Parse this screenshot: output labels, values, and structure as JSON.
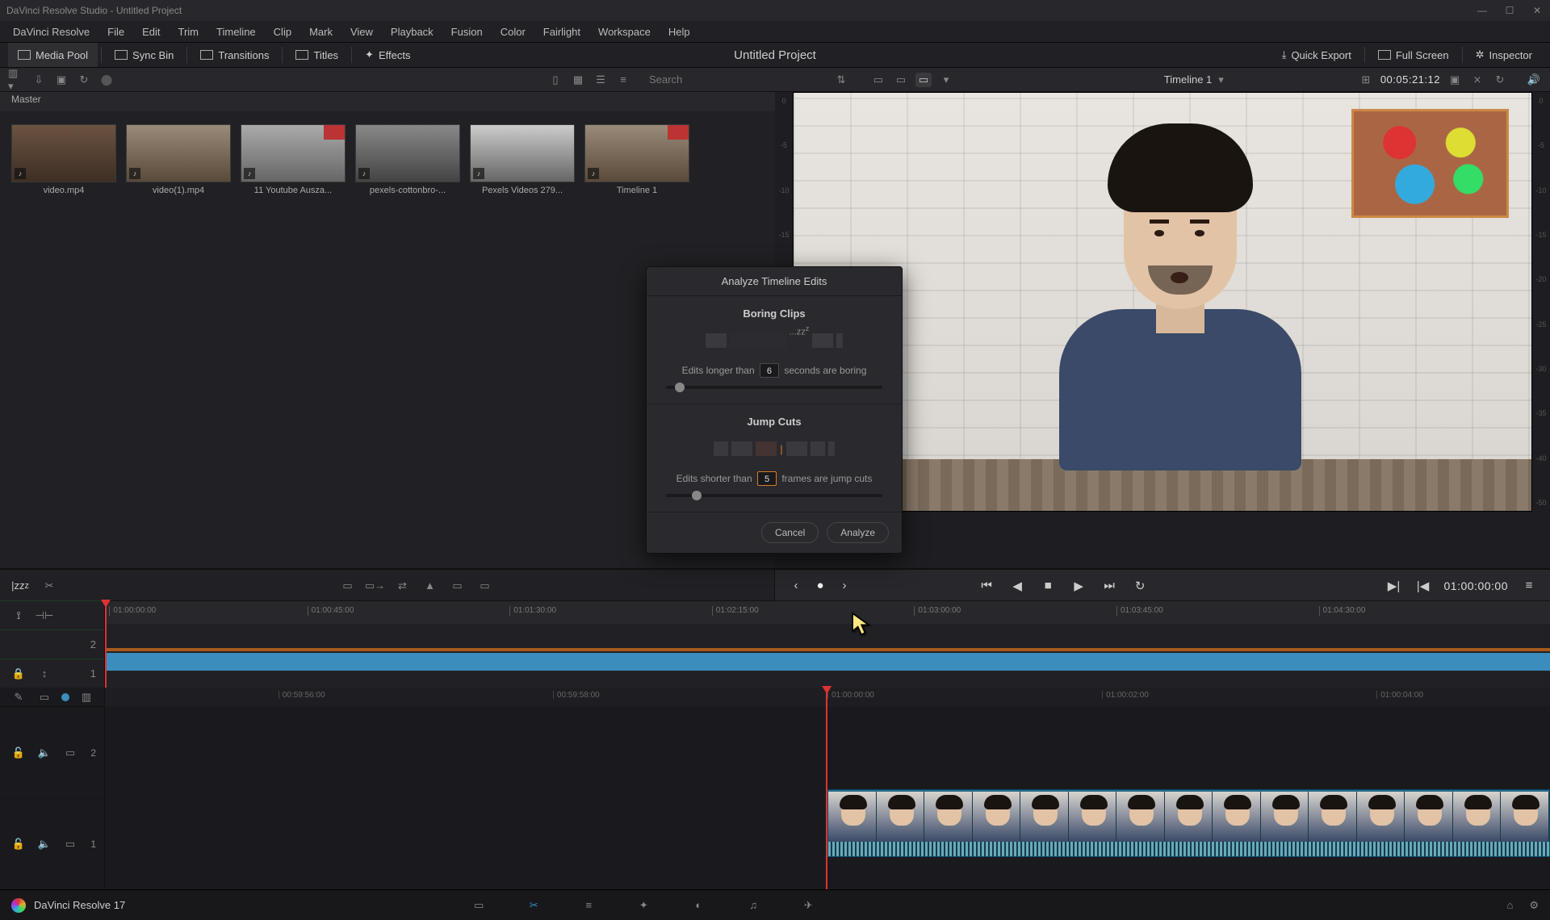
{
  "window": {
    "title": "DaVinci Resolve Studio - Untitled Project"
  },
  "menus": [
    "DaVinci Resolve",
    "File",
    "Edit",
    "Trim",
    "Timeline",
    "Clip",
    "Mark",
    "View",
    "Playback",
    "Fusion",
    "Color",
    "Fairlight",
    "Workspace",
    "Help"
  ],
  "toolbar": {
    "media_pool": "Media Pool",
    "sync_bin": "Sync Bin",
    "transitions": "Transitions",
    "titles": "Titles",
    "effects": "Effects",
    "project": "Untitled Project",
    "quick_export": "Quick Export",
    "full_screen": "Full Screen",
    "inspector": "Inspector"
  },
  "pool": {
    "master": "Master",
    "search_placeholder": "Search",
    "clips": [
      {
        "label": "video.mp4"
      },
      {
        "label": "video(1).mp4"
      },
      {
        "label": "11 Youtube Ausza..."
      },
      {
        "label": "pexels-cottonbro-..."
      },
      {
        "label": "Pexels Videos 279..."
      },
      {
        "label": "Timeline 1"
      }
    ]
  },
  "viewer": {
    "timeline_name": "Timeline 1",
    "source_tc": "00:05:21:12",
    "play_tc": "01:00:00:00",
    "scale": [
      "0",
      "-5",
      "-10",
      "-15",
      "-20",
      "-25",
      "-30",
      "-35",
      "-40",
      "-50"
    ]
  },
  "ruler_upper": [
    "01:00:00:00",
    "01:00:45:00",
    "01:01:30:00",
    "01:02:15:00",
    "01:03:00:00",
    "01:03:45:00",
    "01:04:30:00"
  ],
  "ruler_lower": [
    "00:59:56:00",
    "00:59:58:00",
    "01:00:00:00",
    "01:00:02:00",
    "01:00:04:00"
  ],
  "tracks": {
    "v2": "2",
    "v1": "1",
    "a2": "2",
    "a1": "1"
  },
  "dialog": {
    "title": "Analyze Timeline Edits",
    "boring_title": "Boring Clips",
    "boring_pre": "Edits longer than",
    "boring_val": "6",
    "boring_post": "seconds are boring",
    "jump_title": "Jump Cuts",
    "jump_pre": "Edits shorter than",
    "jump_val": "5",
    "jump_post": "frames are jump cuts",
    "cancel": "Cancel",
    "analyze": "Analyze"
  },
  "footer": {
    "app": "DaVinci Resolve 17"
  }
}
